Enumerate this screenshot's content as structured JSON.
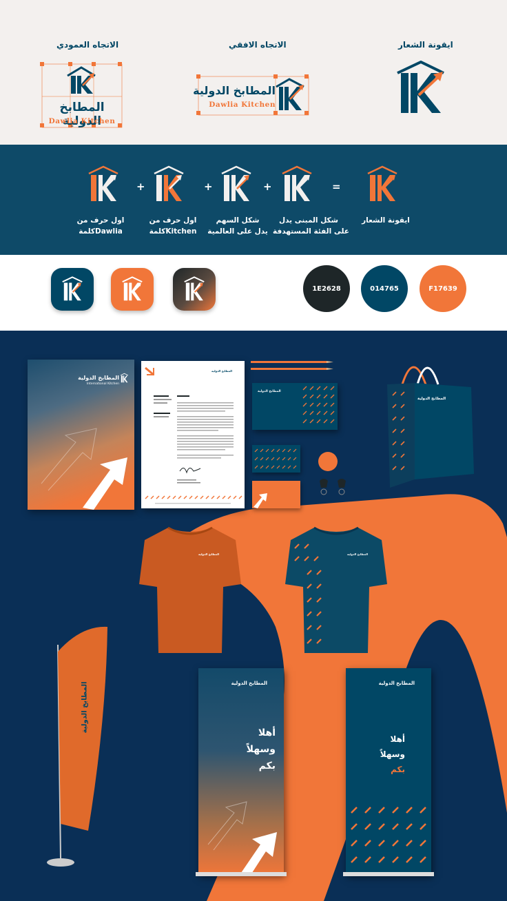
{
  "top": {
    "vertical_caption": "الاتجاه العمودي",
    "horizontal_caption": "الاتجاه الافقي",
    "icon_caption": "ايقونة الشعار",
    "logo_arabic": "المطابخ الدولية",
    "logo_english": "Dawlia Kitchen"
  },
  "construction": {
    "descriptions": [
      {
        "line1": "اول حرف من",
        "line2": "كلمةDawlia"
      },
      {
        "line1": "اول حرف من",
        "line2": "كلمةKitchen"
      },
      {
        "line1": "شكل السهم",
        "line2": "يدل على العالمية"
      },
      {
        "line1": "شكل المبنى يدل",
        "line2": "على الفئة المستهدفة"
      },
      {
        "line1": "ايقونة الشعار",
        "line2": ""
      }
    ],
    "operators": [
      "+",
      "+",
      "+",
      "="
    ]
  },
  "palette": {
    "swatches": [
      {
        "label": "1E2628",
        "color": "#1e2628"
      },
      {
        "label": "014765",
        "color": "#014765"
      },
      {
        "label": "F17639",
        "color": "#f17639"
      }
    ],
    "app_icons": [
      {
        "name": "blue",
        "bg": "#014765"
      },
      {
        "name": "orange",
        "bg": "#f17639"
      },
      {
        "name": "gradient",
        "bg": "gradient"
      }
    ]
  },
  "mockups": {
    "brand_arabic": "المطابخ الدولية",
    "brand_english": "International Kitchen",
    "banner_welcome": [
      "أهلا",
      "وسهلاً",
      "بكم"
    ]
  },
  "colors": {
    "navy": "#014765",
    "orange": "#f17639",
    "dark": "#1e2628",
    "deep_blue": "#0a2f56"
  }
}
